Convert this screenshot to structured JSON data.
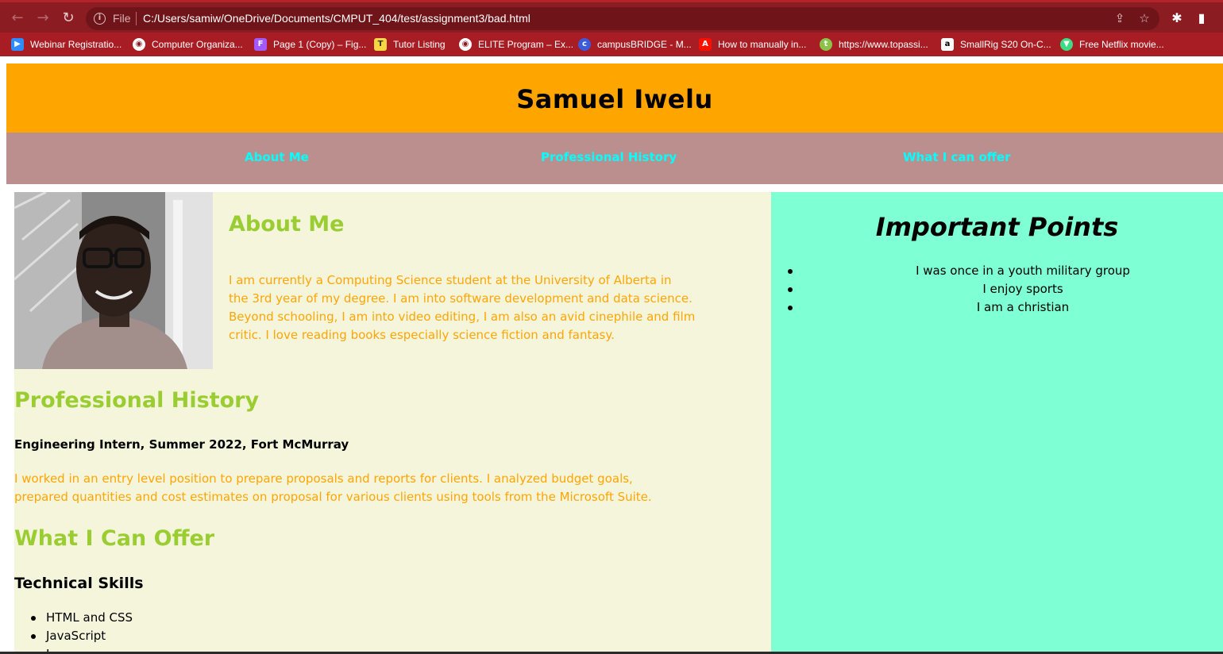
{
  "browser": {
    "file_label": "File",
    "url": "C:/Users/samiw/OneDrive/Documents/CMPUT_404/test/assignment3/bad.html",
    "bookmarks": [
      {
        "label": "Webinar Registratio...",
        "icon": "zoom-icon",
        "color": "#2d8cff"
      },
      {
        "label": "Computer Organiza...",
        "icon": "globe-icon",
        "color": "#ffffff"
      },
      {
        "label": "Page 1 (Copy) – Fig...",
        "icon": "figma-icon",
        "color": "#f24e1e"
      },
      {
        "label": "Tutor Listing",
        "icon": "tutor-icon",
        "color": "#f6d743"
      },
      {
        "label": "ELITE Program – Ex...",
        "icon": "globe-icon",
        "color": "#ffffff"
      },
      {
        "label": "campusBRIDGE - M...",
        "icon": "campusbridge-icon",
        "color": "#3b5bdb"
      },
      {
        "label": "How to manually in...",
        "icon": "adobe-icon",
        "color": "#fa0f00"
      },
      {
        "label": "https://www.topassi...",
        "icon": "topassist-icon",
        "color": "#8bc34a"
      },
      {
        "label": "SmallRig S20 On-C...",
        "icon": "amazon-icon",
        "color": "#ffffff"
      },
      {
        "label": "Free Netflix movie...",
        "icon": "netflix-icon",
        "color": "#3ddc84"
      }
    ]
  },
  "page": {
    "header_title": "Samuel Iwelu",
    "nav": [
      "About Me",
      "Professional History",
      "What I can offer"
    ],
    "about": {
      "heading": "About Me",
      "lines": [
        "I am currently a Computing Science student at the University of Alberta in",
        "the 3rd year of my degree. I am into software development and data science.",
        "Beyond schooling, I am into video editing, I am also an avid cinephile and film",
        "critic. I love reading books especially science fiction and fantasy."
      ]
    },
    "history": {
      "heading": "Professional History",
      "job_title": "Engineering Intern, Summer 2022, Fort McMurray",
      "lines": [
        "I worked in an entry level position to prepare proposals and reports for clients. I analyzed budget goals,",
        "prepared quantities and cost estimates on proposal for various clients using tools from the Microsoft Suite."
      ]
    },
    "offer": {
      "heading": "What I Can Offer",
      "subheading": "Technical Skills",
      "skills": [
        "HTML and CSS",
        "JavaScript",
        "J"
      ]
    },
    "sidebar": {
      "title": "Important Points",
      "points": [
        "I was once in a youth military group",
        "I enjoy sports",
        "I am a christian"
      ]
    },
    "colors": {
      "header_bg": "#ffa500",
      "nav_bg": "#bc8f8f",
      "nav_link": "#00ffff",
      "main_bg": "#f5f5dc",
      "sidebar_bg": "#7fffd4",
      "heading": "#9acd32",
      "paragraph": "#ffa500",
      "browser_frame": "#8b1c22"
    }
  }
}
